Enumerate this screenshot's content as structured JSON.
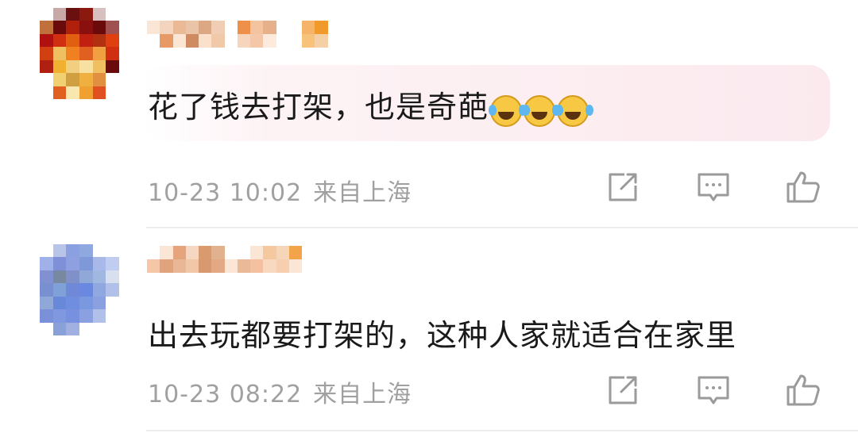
{
  "comments": [
    {
      "username_masked": "",
      "text": "花了钱去打架，也是奇葩",
      "emojis": [
        "laugh-cry-emoji",
        "laugh-cry-emoji",
        "laugh-cry-emoji"
      ],
      "time": "10-23 10:02",
      "location": "来自上海",
      "highlighted": true
    },
    {
      "username_masked": "",
      "text": "出去玩都要打架的，这种人家就适合在家里",
      "emojis": [],
      "time": "10-23 08:22",
      "location": "来自上海",
      "highlighted": false
    }
  ],
  "icons": {
    "share": "share-icon",
    "reply": "comment-icon",
    "like": "thumbs-up-icon"
  },
  "colors": {
    "text": "#1a1a1a",
    "meta": "#a0a0a0",
    "icon": "#9a9a9a",
    "highlight": "#fbe9ee",
    "divider": "#ededed"
  }
}
